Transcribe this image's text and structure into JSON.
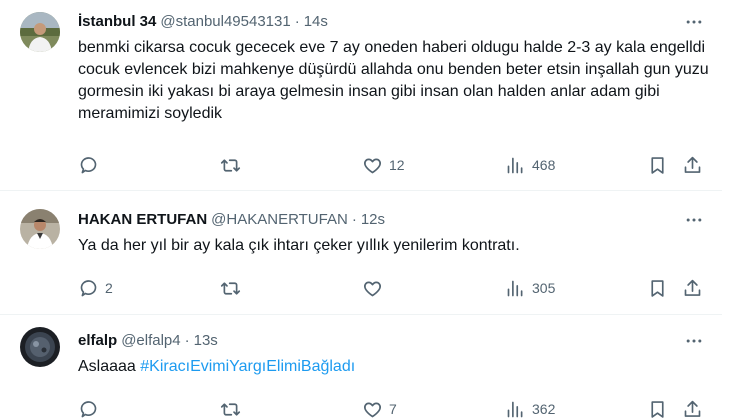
{
  "tweets": [
    {
      "name": "İstanbul 34",
      "handle": "@stanbul49543131",
      "time": "14s",
      "text": "benmki cikarsa cocuk gececek eve 7 ay oneden haberi oldugu halde 2-3 ay kala engelldi cocuk evlencek bizi mahkenye düşürdü allahda onu benden beter etsin inşallah gun yuzu gormesin iki yakası bi araya gelmesin insan gibi insan olan halden anlar adam gibi meramimizi soyledik",
      "replies": "",
      "retweets": "",
      "likes": "12",
      "views": "468"
    },
    {
      "name": "HAKAN ERTUFAN",
      "handle": "@HAKANERTUFAN",
      "time": "12s",
      "text": "Ya da her yıl bir ay kala çık ihtarı çeker yıllık yenilerim kontratı.",
      "replies": "2",
      "retweets": "",
      "likes": "",
      "views": "305"
    },
    {
      "name": "elfalp",
      "handle": "@elfalp4",
      "time": "13s",
      "text_prefix": "Aslaaaa ",
      "hashtag": "#KiracıEvimiYargıElimiBağladı",
      "replies": "",
      "retweets": "",
      "likes": "7",
      "views": "362"
    }
  ],
  "separator": "·",
  "icons": [
    "more-icon",
    "reply-icon",
    "retweet-icon",
    "like-icon",
    "views-icon",
    "bookmark-icon",
    "share-icon"
  ],
  "colors": {
    "text": "#0f1419",
    "secondary": "#536471",
    "link": "#1d9bf0",
    "divider": "#eff3f4"
  }
}
